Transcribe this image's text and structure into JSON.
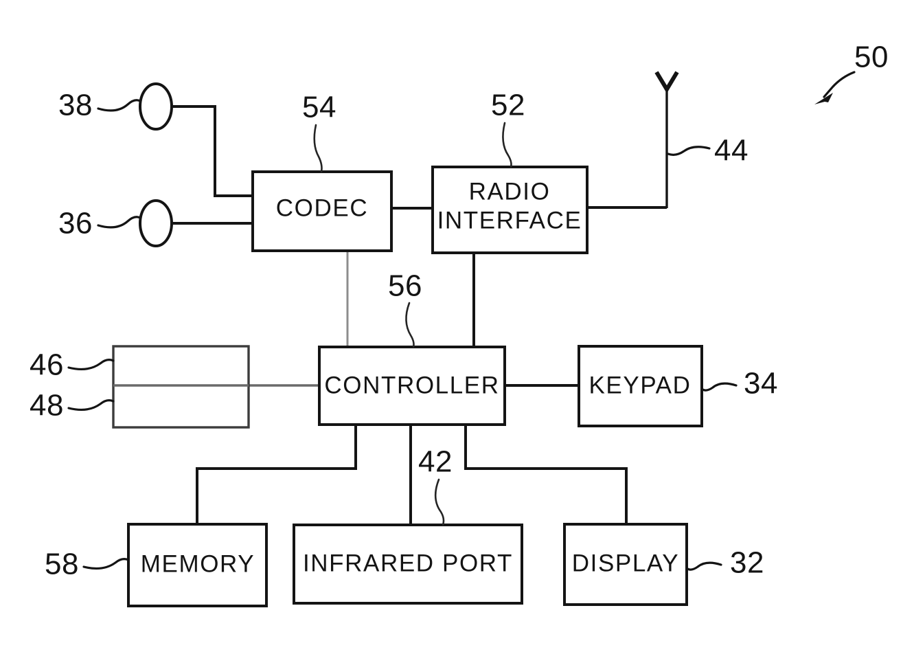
{
  "figure": {
    "kind": "patent-block-diagram",
    "title": "Mobile terminal block diagram",
    "assembly_ref": "50",
    "background_color": "#ffffff",
    "line_color": "#141414"
  },
  "blocks": [
    {
      "id": "codec",
      "label": "CODEC",
      "ref": "54"
    },
    {
      "id": "radio-interface",
      "label": "RADIO\nINTERFACE",
      "ref": "52",
      "line1": "RADIO",
      "line2": "INTERFACE"
    },
    {
      "id": "controller",
      "label": "CONTROLLER",
      "ref": "56"
    },
    {
      "id": "keypad",
      "label": "KEYPAD",
      "ref": "34"
    },
    {
      "id": "memory",
      "label": "MEMORY",
      "ref": "58"
    },
    {
      "id": "infrared-port",
      "label": "INFRARED PORT",
      "ref": "42"
    },
    {
      "id": "display",
      "label": "DISPLAY",
      "ref": "32"
    },
    {
      "id": "dual-module",
      "label": "",
      "ref_top": "46",
      "ref_bottom": "48"
    }
  ],
  "transducers": [
    {
      "id": "speaker",
      "ref": "38",
      "shape": "ellipse"
    },
    {
      "id": "microphone",
      "ref": "36",
      "shape": "ellipse"
    }
  ],
  "antenna": {
    "id": "antenna",
    "ref": "44",
    "shape": "whip-with-v-tip"
  },
  "refs": {
    "r32": "32",
    "r34": "34",
    "r36": "36",
    "r38": "38",
    "r42": "42",
    "r44": "44",
    "r46": "46",
    "r48": "48",
    "r50": "50",
    "r52": "52",
    "r54": "54",
    "r56": "56",
    "r58": "58"
  },
  "labels": {
    "codec": "CODEC",
    "radio_line1": "RADIO",
    "radio_line2": "INTERFACE",
    "controller": "CONTROLLER",
    "keypad": "KEYPAD",
    "memory": "MEMORY",
    "infrared_port": "INFRARED PORT",
    "display": "DISPLAY"
  }
}
